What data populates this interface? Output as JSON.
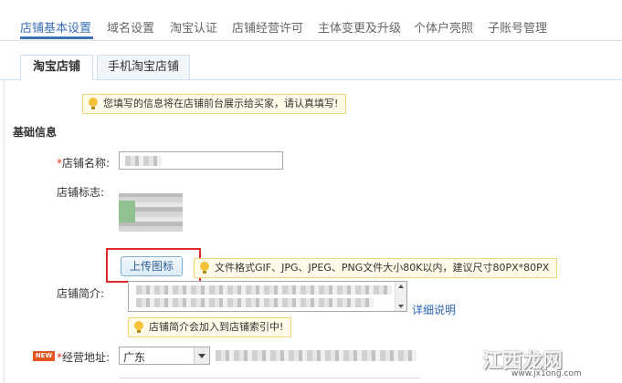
{
  "top_nav": {
    "items": [
      {
        "label": "店铺基本设置",
        "active": true
      },
      {
        "label": "域名设置",
        "active": false
      },
      {
        "label": "淘宝认证",
        "active": false
      },
      {
        "label": "店铺经营许可",
        "active": false
      },
      {
        "label": "主体变更及升级",
        "active": false
      },
      {
        "label": "个体户亮照",
        "active": false
      },
      {
        "label": "子账号管理",
        "active": false
      }
    ]
  },
  "sub_tabs": [
    {
      "label": "淘宝店铺",
      "active": true
    },
    {
      "label": "手机淘宝店铺",
      "active": false
    }
  ],
  "notice_top": "您填写的信息将在店铺前台展示给买家，请认真填写!",
  "section_title": "基础信息",
  "form": {
    "store_name": {
      "required_mark": "*",
      "label": "店铺名称:"
    },
    "store_logo": {
      "label": "店铺标志:",
      "upload_button": "上传图标",
      "hint": "文件格式GIF、JPG、JPEG、PNG文件大小80K以内，建议尺寸80PX*80PX"
    },
    "store_intro": {
      "label": "店铺简介:",
      "detail_link": "详细说明",
      "hint": "店铺简介会加入到店铺索引中!"
    },
    "address": {
      "badge": "NEW",
      "required_mark": "*",
      "label": "经营地址:",
      "province": "广东"
    }
  },
  "watermark": {
    "text": "江西龙网",
    "url": "www.jx1ong.com"
  },
  "colors": {
    "accent": "#3b6fb6",
    "required": "#e0301e",
    "highlight": "#e02a2a",
    "notice_bg": "#fffbe8"
  }
}
